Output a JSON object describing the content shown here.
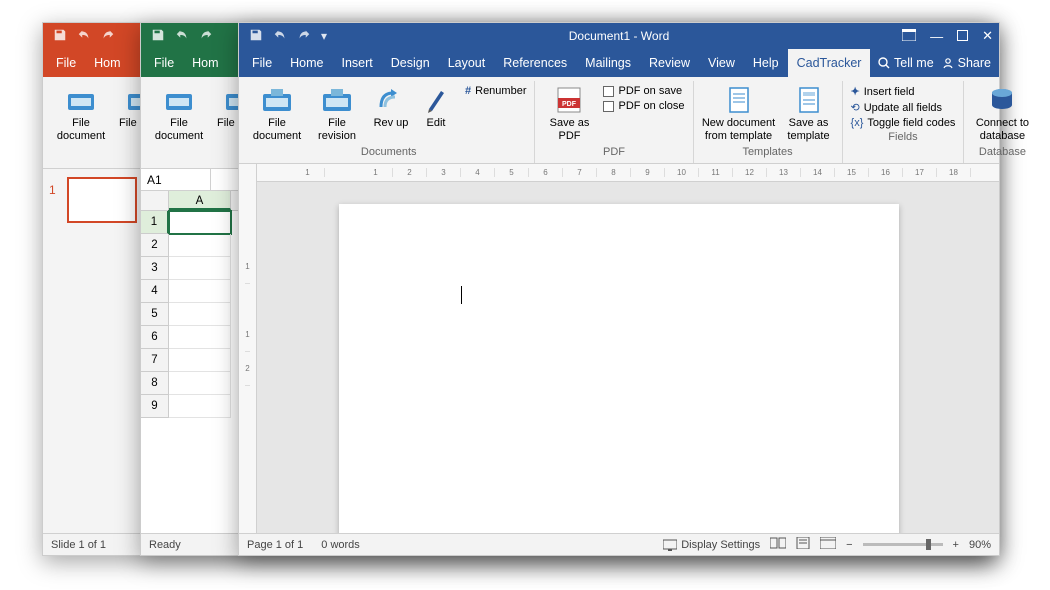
{
  "word": {
    "title": "Document1 - Word",
    "tabs": [
      "File",
      "Home",
      "Insert",
      "Design",
      "Layout",
      "References",
      "Mailings",
      "Review",
      "View",
      "Help",
      "CadTracker"
    ],
    "active_tab": "CadTracker",
    "tellme": "Tell me",
    "share": "Share",
    "ribbon": {
      "documents": {
        "label": "Documents",
        "file_document": "File document",
        "file_revision": "File revision",
        "rev_up": "Rev up",
        "edit": "Edit",
        "renumber": "Renumber"
      },
      "pdf": {
        "label": "PDF",
        "save_as_pdf": "Save as PDF",
        "pdf_on_save": "PDF on save",
        "pdf_on_close": "PDF on close"
      },
      "templates": {
        "label": "Templates",
        "new_doc": "New document from template",
        "save_as_template": "Save as template"
      },
      "fields": {
        "label": "Fields",
        "insert_field": "Insert field",
        "update_all": "Update all fields",
        "toggle": "Toggle field codes"
      },
      "database": {
        "label": "Database",
        "connect": "Connect to database"
      }
    },
    "ruler_numbers": [
      "",
      "1",
      "",
      "1",
      "2",
      "3",
      "4",
      "5",
      "6",
      "7",
      "8",
      "9",
      "10",
      "11",
      "12",
      "13",
      "14",
      "15",
      "16",
      "17",
      "18"
    ],
    "rulerV_numbers": [
      "",
      "",
      "1",
      "",
      "1",
      "2"
    ],
    "status": {
      "page": "Page 1 of 1",
      "words": "0 words",
      "display_settings": "Display Settings",
      "zoom": "90%"
    }
  },
  "excel": {
    "tabs": [
      "File",
      "Hom"
    ],
    "ribbon": {
      "file_document": "File document",
      "file_revis": "File revis"
    },
    "namebox": "A1",
    "cols": [
      "A"
    ],
    "rows": [
      1,
      2,
      3,
      4,
      5,
      6,
      7,
      8,
      9
    ],
    "status": "Ready"
  },
  "powerpoint": {
    "tabs": [
      "File",
      "Hom"
    ],
    "ribbon": {
      "file_document": "File document",
      "file_revis": "File revis"
    },
    "slide_num": "1",
    "status": "Slide 1 of 1"
  }
}
